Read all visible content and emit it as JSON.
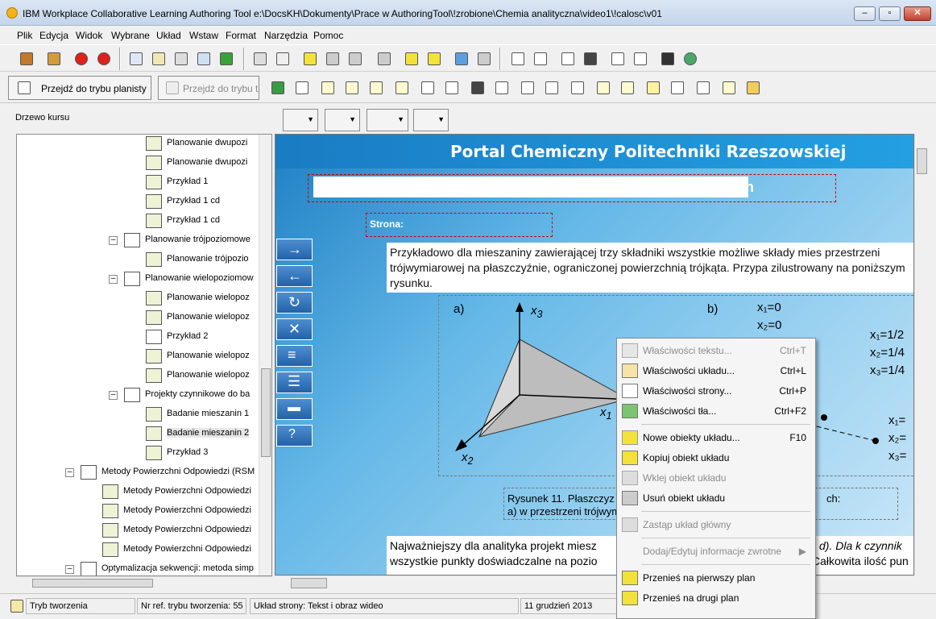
{
  "window": {
    "title": "IBM Workplace Collaborative Learning Authoring Tool   e:\\DocsKH\\Dokumenty\\Prace w AuthoringTool\\!zrobione\\Chemia analityczna\\video1\\!calosc\\v01"
  },
  "menu": [
    "Plik",
    "Edycja",
    "Widok",
    "Wybrane",
    "Układ",
    "Wstaw",
    "Format",
    "Narzędzia",
    "Pomoc"
  ],
  "toolbar2": {
    "planner_label": "Przejdź do trybu planisty",
    "tree_mode_label": "Przejdź do trybu t"
  },
  "tree": {
    "label": "Drzewo kursu",
    "items": [
      {
        "label": "Planowanie dwupozi"
      },
      {
        "label": "Planowanie dwupozi"
      },
      {
        "label": "Przykład 1"
      },
      {
        "label": "Przykład 1 cd"
      },
      {
        "label": "Przykład 1 cd"
      },
      {
        "label": "Planowanie trójpoziomowe"
      },
      {
        "label": "Planowanie trójpozio"
      },
      {
        "label": "Planowanie wielopoziomow"
      },
      {
        "label": "Planowanie wielopoz"
      },
      {
        "label": "Planowanie wielopoz"
      },
      {
        "label": "Przykład 2"
      },
      {
        "label": "Planowanie wielopoz"
      },
      {
        "label": "Planowanie wielopoz"
      },
      {
        "label": "Projekty czynnikowe do ba"
      },
      {
        "label": "Badanie mieszanin 1"
      },
      {
        "label": "Badanie mieszanin 2"
      },
      {
        "label": "Przykład 3"
      },
      {
        "label": "Metody Powierzchni Odpowiedzi (RSM"
      },
      {
        "label": "Metody Powierzchni Odpowiedzi"
      },
      {
        "label": "Metody Powierzchni Odpowiedzi"
      },
      {
        "label": "Metody Powierzchni Odpowiedzi"
      },
      {
        "label": "Metody Powierzchni Odpowiedzi"
      },
      {
        "label": "Optymalizacja sekwencji: metoda simp"
      }
    ]
  },
  "page": {
    "portal_title": "Portal Chemiczny Politechniki Rzeszowskiej",
    "header_field_tail": "n",
    "strona_label": "Strona:",
    "para1": "Przykładowo dla mieszaniny zawierającej trzy składniki wszystkie możliwe składy mies przestrzeni trójwymiarowej na płaszczyźnie, ograniczonej powierzchnią trójkąta. Przypa zilustrowany na poniższym rysunku.",
    "fig_a": "a)",
    "fig_b": "b)",
    "x3": "x",
    "x3_sub": "3",
    "x1": "x",
    "x1_sub": "1",
    "x2": "x",
    "x2_sub": "2",
    "b_eq1": "x₁=0",
    "b_eq2": "x₂=0",
    "b_eq3": "x₁=1/2",
    "b_eq4": "x₂=1/4",
    "b_eq5": "x₃=1/4",
    "b_eq6": "x₁=",
    "b_eq7": "x₂=",
    "b_eq8": "x₃=",
    "caption_line1": "Rysunek 11. Płaszczyz",
    "caption_line1b": "ch:",
    "caption_line2": "a) w przestrzeni trójwym",
    "para2_line1": "Najważniejszy dla analityka projekt miesz",
    "para2_line1b": "d). Dla k czynnik",
    "para2_line2": "wszystkie punkty doświadczalne na pozio",
    "para2_line2b": "Całkowita ilość pun"
  },
  "context_menu": {
    "items": [
      {
        "label": "Właściwości tekstu...",
        "shortcut": "Ctrl+T",
        "disabled": true
      },
      {
        "label": "Właściwości układu...",
        "shortcut": "Ctrl+L",
        "disabled": false
      },
      {
        "label": "Właściwości strony...",
        "shortcut": "Ctrl+P",
        "disabled": false
      },
      {
        "label": "Właściwości tła...",
        "shortcut": "Ctrl+F2",
        "disabled": false
      },
      {
        "label": "Nowe obiekty układu...",
        "shortcut": "F10",
        "disabled": false
      },
      {
        "label": "Kopiuj obiekt układu",
        "shortcut": "",
        "disabled": false
      },
      {
        "label": "Wklej obiekt układu",
        "shortcut": "",
        "disabled": true
      },
      {
        "label": "Usuń obiekt układu",
        "shortcut": "",
        "disabled": false
      },
      {
        "label": "Zastąp układ główny",
        "shortcut": "",
        "disabled": true
      },
      {
        "label": "Dodaj/Edytuj informacje zwrotne",
        "shortcut": "▶",
        "disabled": true
      },
      {
        "label": "Przenieś na pierwszy plan",
        "shortcut": "",
        "disabled": false
      },
      {
        "label": "Przenieś na drugi plan",
        "shortcut": "",
        "disabled": false
      }
    ]
  },
  "status": {
    "mode": "Tryb tworzenia",
    "ref": "Nr ref. trybu tworzenia: 55",
    "layout": "Układ strony: Tekst i obraz wideo",
    "date": "11 grudzień 2013"
  }
}
